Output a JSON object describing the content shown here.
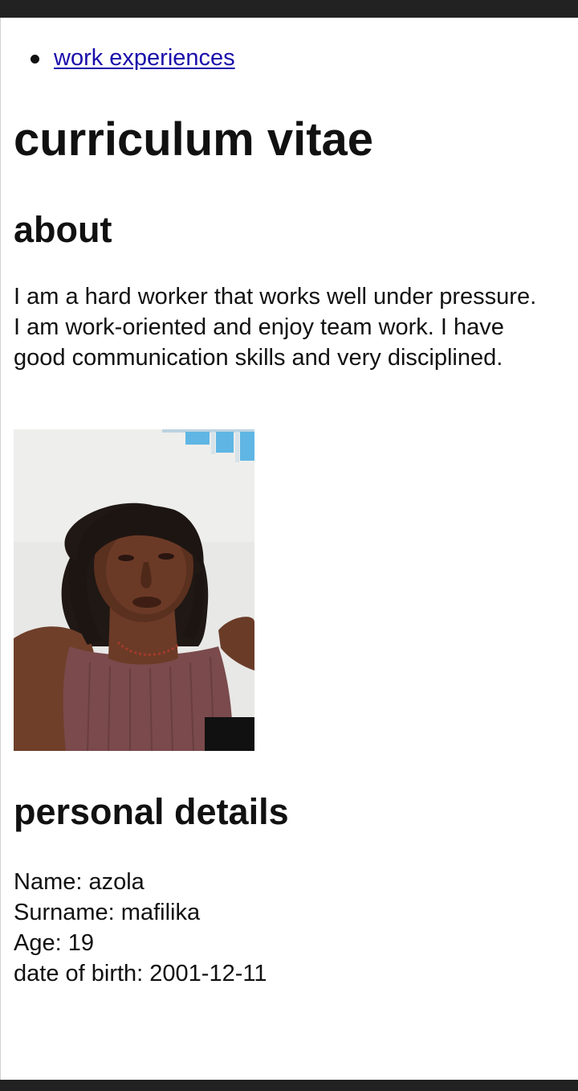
{
  "nav": {
    "items": [
      {
        "label": "work experiences"
      }
    ]
  },
  "page_title": "curriculum vitae",
  "about": {
    "heading": "about",
    "text": "I am a hard worker that works well under pressure. I am work-oriented and enjoy team work. I have good communication skills and very disciplined."
  },
  "photo": {
    "subject": "portrait photo of a young woman with shoulder-length dark hair wearing a mauve ribbed tank top and bead necklace"
  },
  "personal_details": {
    "heading": "personal details",
    "lines": [
      "Name: azola",
      "Surname: mafilika",
      "Age: 19",
      "date of birth: 2001-12-11"
    ]
  },
  "colors": {
    "link": "#1a0dab",
    "text": "#111111",
    "system_bars": "#222222"
  }
}
